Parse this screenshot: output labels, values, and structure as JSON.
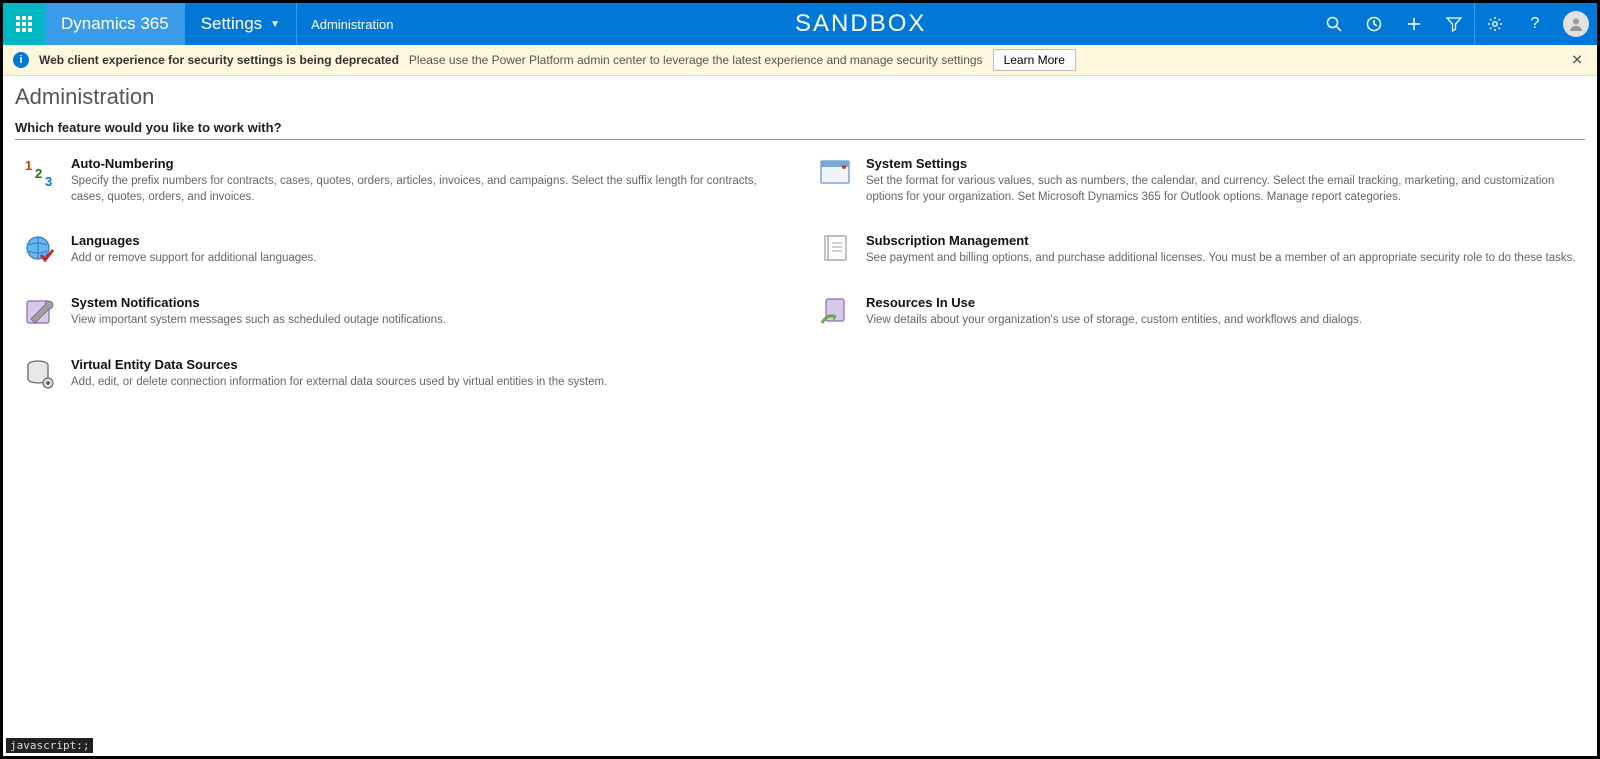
{
  "nav": {
    "brand": "Dynamics 365",
    "area": "Settings",
    "breadcrumb": "Administration",
    "env": "SANDBOX"
  },
  "notif": {
    "bold": "Web client experience for security settings is being deprecated",
    "msg": "Please use the Power Platform admin center to leverage the latest experience and manage security settings",
    "button": "Learn More"
  },
  "page": {
    "title": "Administration",
    "prompt": "Which feature would you like to work with?"
  },
  "tiles": {
    "auto_numbering": {
      "title": "Auto-Numbering",
      "desc": "Specify the prefix numbers for contracts, cases, quotes, orders, articles, invoices, and campaigns. Select the suffix length for contracts, cases, quotes, orders, and invoices."
    },
    "system_settings": {
      "title": "System Settings",
      "desc": "Set the format for various values, such as numbers, the calendar, and currency. Select the email tracking, marketing, and customization options for your organization. Set Microsoft Dynamics 365 for Outlook options. Manage report categories."
    },
    "languages": {
      "title": "Languages",
      "desc": "Add or remove support for additional languages."
    },
    "subscription": {
      "title": "Subscription Management",
      "desc": "See payment and billing options, and purchase additional licenses. You must be a member of an appropriate security role to do these tasks."
    },
    "notifications": {
      "title": "System Notifications",
      "desc": "View important system messages such as scheduled outage notifications."
    },
    "resources": {
      "title": "Resources In Use",
      "desc": "View details about your organization's use of storage, custom entities, and workflows and dialogs."
    },
    "virtual_entity": {
      "title": "Virtual Entity Data Sources",
      "desc": "Add, edit, or delete connection information for external data sources used by virtual entities in the system."
    }
  },
  "status": "javascript:;"
}
